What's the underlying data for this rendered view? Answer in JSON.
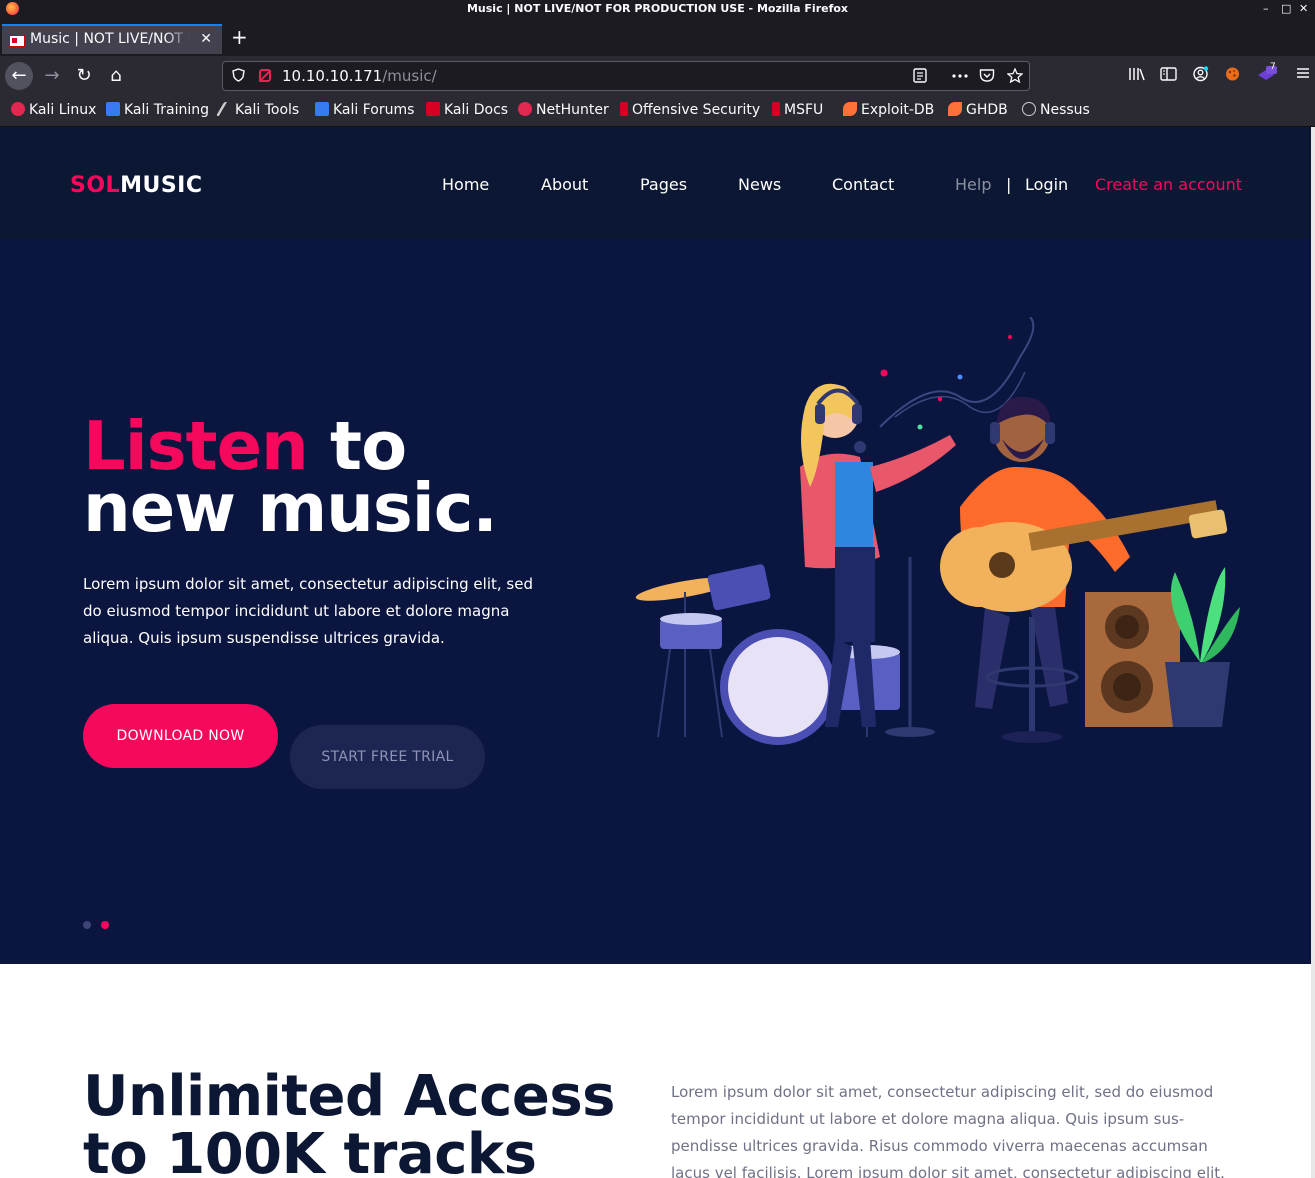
{
  "window": {
    "title": "Music | NOT LIVE/NOT FOR PRODUCTION USE - Mozilla Firefox",
    "controls": [
      "–",
      "□",
      "✕"
    ]
  },
  "tab": {
    "label": "Music | NOT LIVE/NOT FOR PRODUCTION USE",
    "close": "✕",
    "new_tab": "+"
  },
  "nav": {
    "back": "←",
    "forward": "→",
    "reload": "↻",
    "home": "⌂",
    "url_host": "10.10.10.171",
    "url_path": "/music/"
  },
  "bookmarks": [
    {
      "label": "Kali Linux",
      "color": "#e22850"
    },
    {
      "label": "Kali Training",
      "color": "#367bf0"
    },
    {
      "label": "Kali Tools",
      "color": "#cccccc"
    },
    {
      "label": "Kali Forums",
      "color": "#367bf0"
    },
    {
      "label": "Kali Docs",
      "color": "#d70022"
    },
    {
      "label": "NetHunter",
      "color": "#e22850"
    },
    {
      "label": "Offensive Security",
      "color": "#d70022"
    },
    {
      "label": "MSFU",
      "color": "#d70022"
    },
    {
      "label": "Exploit-DB",
      "color": "#ff7139"
    },
    {
      "label": "GHDB",
      "color": "#ff7139"
    },
    {
      "label": "Nessus",
      "color": "#cccccc"
    }
  ],
  "extension_badge": "7",
  "site": {
    "logo_a": "SOL",
    "logo_b": "MUSIC",
    "menu": [
      "Home",
      "About",
      "Pages",
      "News",
      "Contact"
    ],
    "help": "Help",
    "separator": "|",
    "login": "Login",
    "create_account": "Create an account"
  },
  "hero": {
    "title_pink": "Listen",
    "title_rest1": " to",
    "title_line2": "new music.",
    "text": "Lorem ipsum dolor sit amet, consectetur adipiscing elit, sed do eiusmod tempor incididunt ut labore et dolore magna aliqua. Quis ipsum suspendisse ultrices gravida.",
    "download_button": "DOWNLOAD NOW",
    "trial_button": "START FREE TRIAL",
    "slides": 2,
    "active_slide": 2
  },
  "section2": {
    "title_line1": "Unlimited Access",
    "title_line2": "to 100K tracks",
    "text": "Lorem ipsum dolor sit amet, consectetur adipiscing elit, sed do eiusmod tempor incididunt ut labore et dolore magna aliqua. Quis ipsum sus-pendisse ultrices gravida. Risus commodo viverra maecenas accumsan lacus vel facilisis. Lorem ipsum dolor sit amet, consectetur adipiscing elit."
  },
  "colors": {
    "accent": "#f6095d",
    "hero_bg": "#0b1640",
    "header_bg": "#0c1833"
  }
}
